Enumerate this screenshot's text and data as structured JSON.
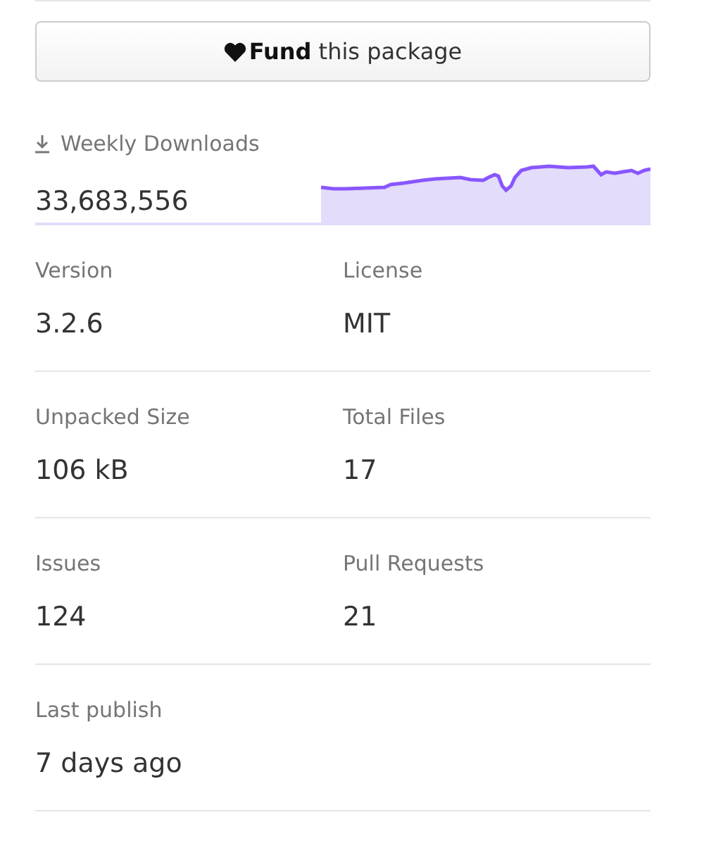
{
  "fund_button": {
    "label": "**Fund** this package"
  },
  "weekly_downloads": {
    "label": "Weekly Downloads",
    "count": "33,683,556"
  },
  "stats": [
    [
      {
        "label": "Version",
        "value": "3.2.6"
      },
      {
        "label": "License",
        "value": "MIT"
      }
    ],
    [
      {
        "label": "Unpacked Size",
        "value": "106 kB"
      },
      {
        "label": "Total Files",
        "value": "17"
      }
    ],
    [
      {
        "label": "Issues",
        "value": "124"
      },
      {
        "label": "Pull Requests",
        "value": "21"
      }
    ],
    [
      {
        "label": "Last publish",
        "value": "7 days ago"
      }
    ]
  ]
}
